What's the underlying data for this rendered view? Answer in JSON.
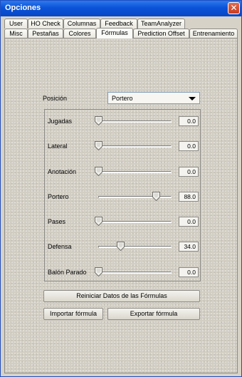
{
  "window": {
    "title": "Opciones",
    "close_glyph": "✕"
  },
  "tabs_row1": [
    "User",
    "HO Check",
    "Columnas",
    "Feedback",
    "TeamAnalyzer"
  ],
  "tabs_row2": [
    "Misc",
    "Pestañas",
    "Colores",
    "Fórmulas",
    "Prediction Offset",
    "Entrenamiento"
  ],
  "active_tab": "Fórmulas",
  "position": {
    "label": "Posición",
    "value": "Portero"
  },
  "sliders": [
    {
      "label": "Jugadas",
      "value": "0.0",
      "fraction": 0.0
    },
    {
      "label": "Lateral",
      "value": "0.0",
      "fraction": 0.0
    },
    {
      "label": "Anotación",
      "value": "0.0",
      "fraction": 0.0
    },
    {
      "label": "Portero",
      "value": "88.0",
      "fraction": 0.88
    },
    {
      "label": "Pases",
      "value": "0.0",
      "fraction": 0.0
    },
    {
      "label": "Defensa",
      "value": "34.0",
      "fraction": 0.34
    },
    {
      "label": "Balón Parado",
      "value": "0.0",
      "fraction": 0.0
    }
  ],
  "buttons": {
    "reset": "Reiniciar Datos de las Fórmulas",
    "import": "Importar fórmula",
    "export": "Exportar fórmula"
  }
}
